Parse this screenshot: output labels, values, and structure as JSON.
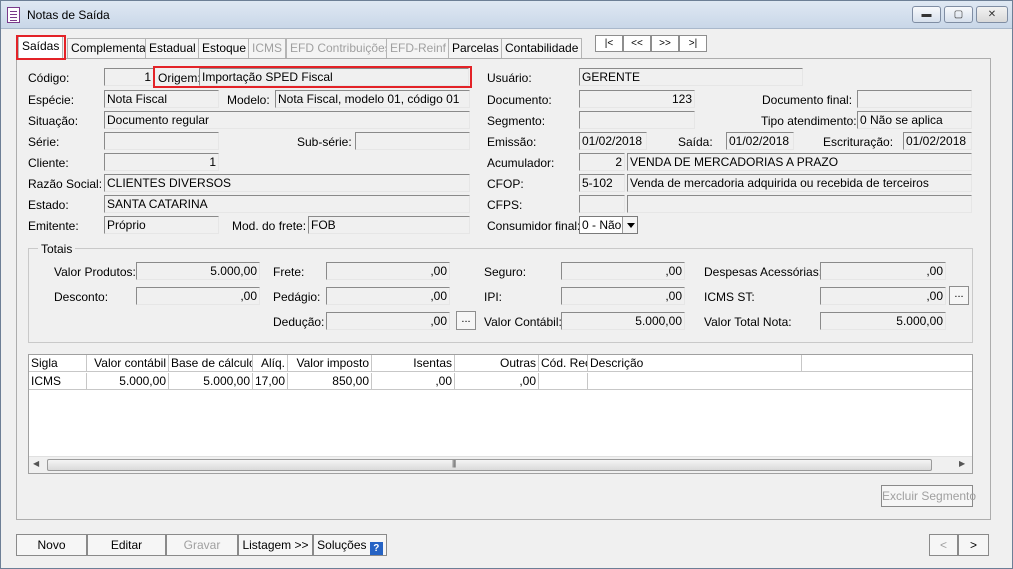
{
  "window": {
    "title": "Notas de Saída",
    "minimize": "▬",
    "maximize": "▢",
    "close": "✕"
  },
  "tabs": [
    {
      "label": "Saídas",
      "active": true,
      "enabled": true
    },
    {
      "label": "Complementar",
      "enabled": true
    },
    {
      "label": "Estadual",
      "enabled": true
    },
    {
      "label": "Estoque",
      "enabled": true
    },
    {
      "label": "ICMS",
      "enabled": false
    },
    {
      "label": "EFD Contribuições",
      "enabled": false
    },
    {
      "label": "EFD-Reinf",
      "enabled": false
    },
    {
      "label": "Parcelas",
      "enabled": true
    },
    {
      "label": "Contabilidade",
      "enabled": true
    }
  ],
  "nav": {
    "first": "|<",
    "prev": "<<",
    "next": ">>",
    "last": ">|"
  },
  "form": {
    "codigo_label": "Código:",
    "codigo_value": "1",
    "origem_label": "Origem:",
    "origem_value": "Importação SPED Fiscal",
    "usuario_label": "Usuário:",
    "usuario_value": "GERENTE",
    "especie_label": "Espécie:",
    "especie_value": "Nota Fiscal",
    "modelo_label": "Modelo:",
    "modelo_value": "Nota Fiscal, modelo 01, código 01",
    "documento_label": "Documento:",
    "documento_value": "123",
    "documento_final_label": "Documento final:",
    "documento_final_value": "",
    "situacao_label": "Situação:",
    "situacao_value": "Documento regular",
    "segmento_label": "Segmento:",
    "segmento_value": "",
    "tipo_atendimento_label": "Tipo atendimento:",
    "tipo_atendimento_value": "0 Não se aplica",
    "serie_label": "Série:",
    "serie_value": "",
    "subserie_label": "Sub-série:",
    "subserie_value": "",
    "emissao_label": "Emissão:",
    "emissao_value": "01/02/2018",
    "saida_label": "Saída:",
    "saida_value": "01/02/2018",
    "escrituracao_label": "Escrituração:",
    "escrituracao_value": "01/02/2018",
    "cliente_label": "Cliente:",
    "cliente_value": "1",
    "acumulador_label": "Acumulador:",
    "acumulador_code": "2",
    "acumulador_desc": "VENDA DE MERCADORIAS A PRAZO",
    "razao_label": "Razão Social:",
    "razao_value": "CLIENTES DIVERSOS",
    "cfop_label": "CFOP:",
    "cfop_code": "5-102",
    "cfop_desc": "Venda de mercadoria adquirida ou recebida de terceiros",
    "estado_label": "Estado:",
    "estado_value": "SANTA CATARINA",
    "cfps_label": "CFPS:",
    "cfps_code": "",
    "cfps_desc": "",
    "emitente_label": "Emitente:",
    "emitente_value": "Próprio",
    "frete_mod_label": "Mod. do frete:",
    "frete_mod_value": "FOB",
    "consumidor_label": "Consumidor final:",
    "consumidor_value": "0 - Não"
  },
  "totais": {
    "title": "Totais",
    "valor_produtos_label": "Valor Produtos:",
    "valor_produtos": "5.000,00",
    "frete_label": "Frete:",
    "frete": ",00",
    "seguro_label": "Seguro:",
    "seguro": ",00",
    "despesas_label": "Despesas Acessórias:",
    "despesas": ",00",
    "desconto_label": "Desconto:",
    "desconto": ",00",
    "pedagio_label": "Pedágio:",
    "pedagio": ",00",
    "ipi_label": "IPI:",
    "ipi": ",00",
    "icms_st_label": "ICMS ST:",
    "icms_st": ",00",
    "deducao_label": "Dedução:",
    "deducao": ",00",
    "valor_contabil_label": "Valor Contábil:",
    "valor_contabil": "5.000,00",
    "valor_total_label": "Valor Total Nota:",
    "valor_total": "5.000,00",
    "more_button": "..."
  },
  "grid": {
    "headers": [
      "Sigla",
      "Valor contábil",
      "Base de cálculo",
      "Alíq.",
      "Valor imposto",
      "Isentas",
      "Outras",
      "Cód. Rec.",
      "Descrição"
    ],
    "rows": [
      [
        "ICMS",
        "5.000,00",
        "5.000,00",
        "17,00",
        "850,00",
        ",00",
        ",00",
        "",
        ""
      ]
    ],
    "scroll_left": "◀",
    "scroll_right": "▶",
    "scroll_grip": "|||"
  },
  "buttons": {
    "excluir_segmento": "Excluir Segmento",
    "novo": "Novo",
    "editar": "Editar",
    "gravar": "Gravar",
    "listagem": "Listagem >>",
    "solucoes": "Soluções",
    "help_icon": "?",
    "prev": "<",
    "next": ">"
  }
}
